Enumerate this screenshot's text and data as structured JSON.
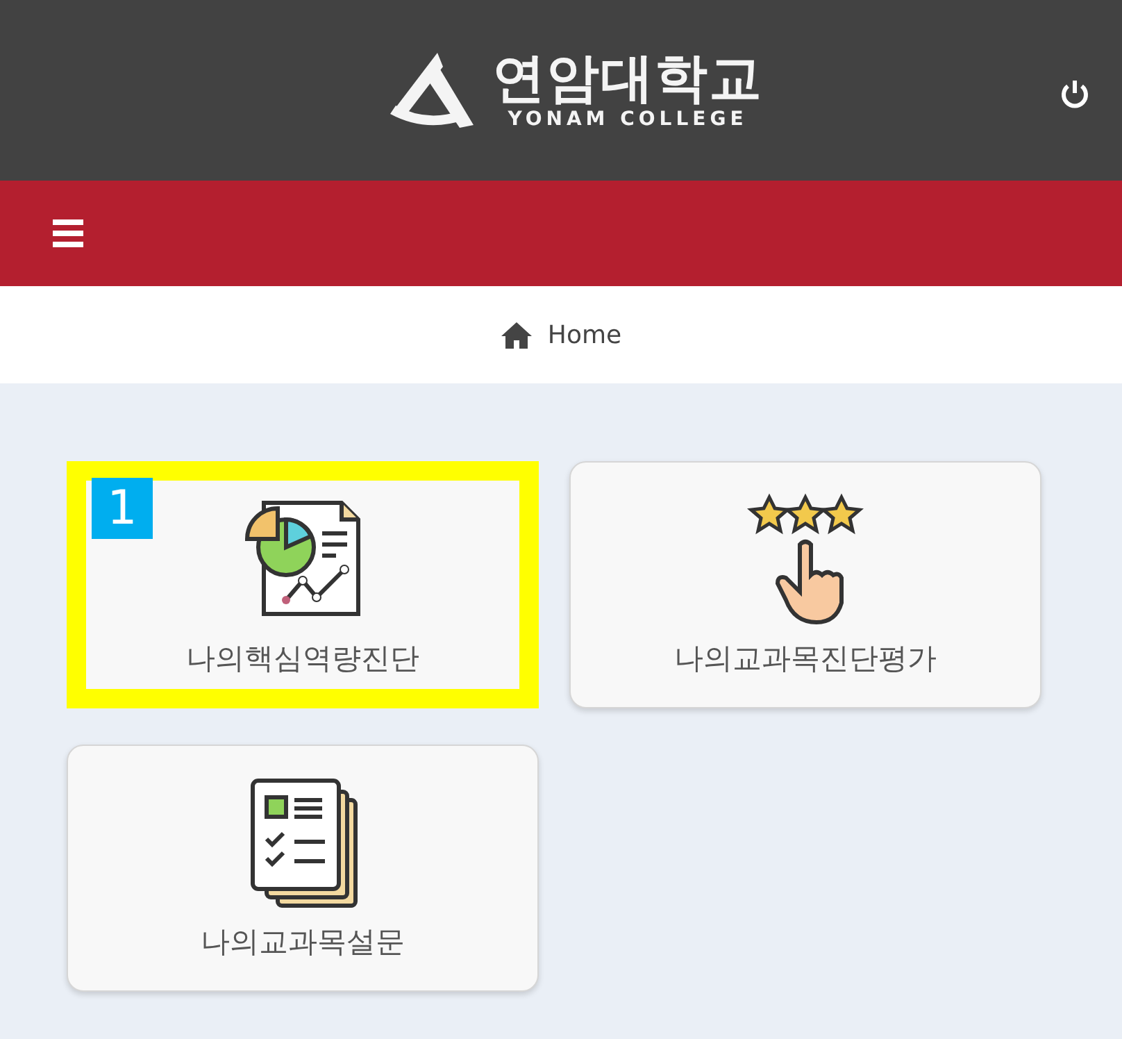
{
  "header": {
    "logo_title": "연암대학교",
    "logo_subtitle": "YONAM COLLEGE"
  },
  "breadcrumb": {
    "label": "Home"
  },
  "cards": [
    {
      "kind": "report",
      "label": "나의핵심역량진단",
      "highlighted": true,
      "badge": "1"
    },
    {
      "kind": "rating",
      "label": "나의교과목진단평가",
      "highlighted": false
    },
    {
      "kind": "survey",
      "label": "나의교과목설문",
      "highlighted": false
    }
  ]
}
